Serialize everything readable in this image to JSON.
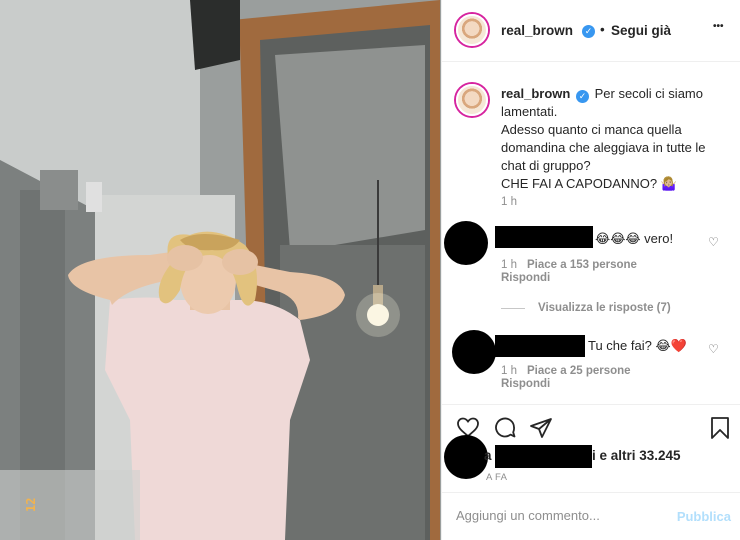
{
  "post": {
    "photo_alt": "",
    "photo_overlay_text": "12"
  },
  "header": {
    "username": "real_brown",
    "verified_icon": "verified-badge-icon",
    "separator": "•",
    "follow_label": "Segui già",
    "more_icon": "more-options-icon",
    "more_label": "•••"
  },
  "caption": {
    "username": "real_brown",
    "lines": [
      "Per secoli ci siamo",
      "lamentati.",
      "Adesso quanto ci manca quella",
      "domandina che aleggiava in tutte le",
      "chat di gruppo?",
      "CHE FAI A CAPODANNO? 🤷🏼‍♀️"
    ],
    "time": "1 h"
  },
  "comments": [
    {
      "text": "😂😂😂 vero!",
      "time": "1 h",
      "likes": "Piace a 153 persone",
      "reply": "Rispondi",
      "view_replies": "Visualizza le risposte (7)"
    },
    {
      "text": "Tu che fai? 😂❤️",
      "time": "1 h",
      "likes": "Piace a 25 persone",
      "reply": "Rispondi"
    }
  ],
  "actions": {
    "like_icon": "heart-icon",
    "comment_icon": "comment-bubble-icon",
    "share_icon": "paper-plane-icon",
    "save_icon": "bookmark-icon",
    "likes_prefix": "a",
    "likes_text": "i e altri 33.245",
    "ago": "A FA"
  },
  "add_comment": {
    "placeholder": "Aggiungi un commento...",
    "publish_label": "Pubblica"
  },
  "colors": {
    "accent": "#3897f0",
    "publish_disabled": "#b2dffc",
    "muted": "#8e8e8e",
    "text": "#262626",
    "heart_red": "#ed4956"
  }
}
